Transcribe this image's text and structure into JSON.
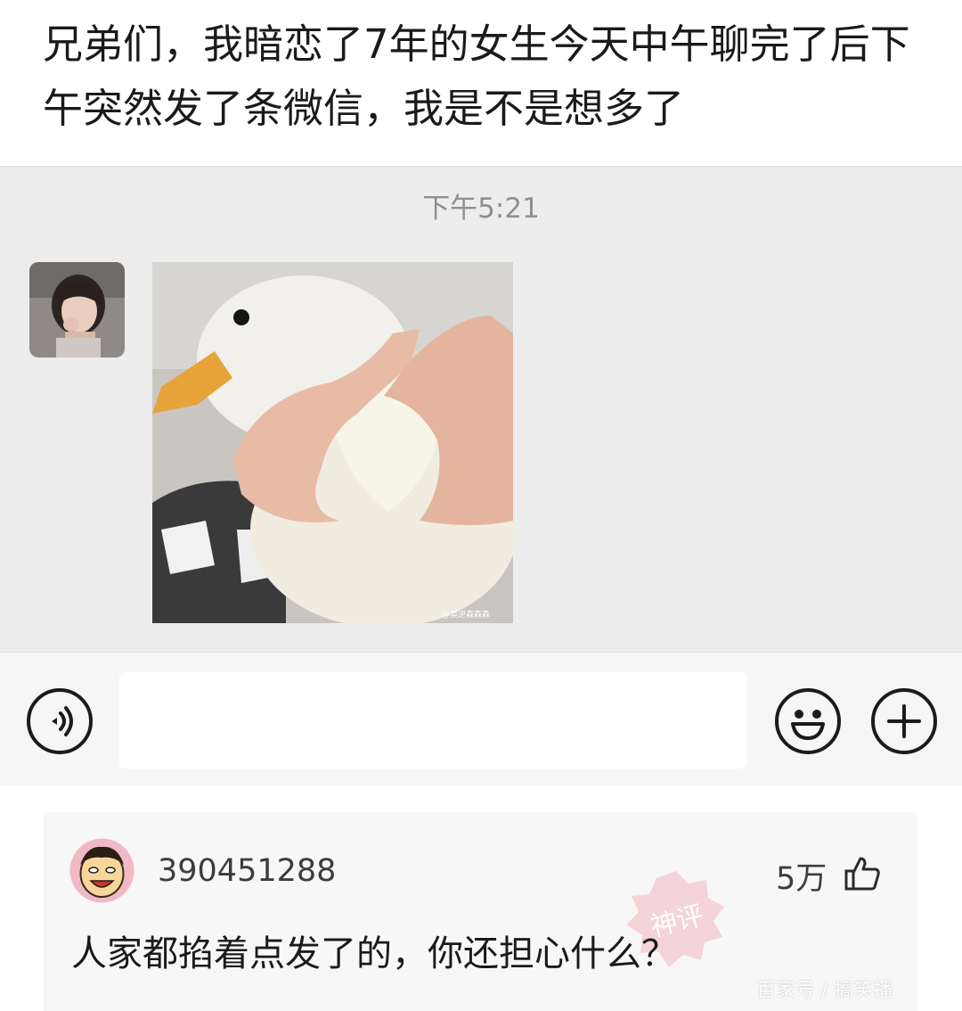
{
  "post": {
    "title": "兄弟们，我暗恋了7年的女生今天中午聊完了后下午突然发了条微信，我是不是想多了"
  },
  "chat": {
    "time": "下午5:21",
    "image_watermark": "@莫逆森森森",
    "icons": {
      "voice": "voice-icon",
      "emoji": "smiley-icon",
      "plus": "plus-icon"
    }
  },
  "comment": {
    "username": "390451288",
    "likes": "5万",
    "text": "人家都掐着点发了的，你还担心什么？",
    "stamp_text": "神评",
    "watermark": "百家号 / 搞笑播"
  },
  "colors": {
    "chat_background": "#ededed",
    "input_bar": "#f6f6f6",
    "comment_background": "#f7f7f7",
    "stamp": "#f07b8c"
  }
}
